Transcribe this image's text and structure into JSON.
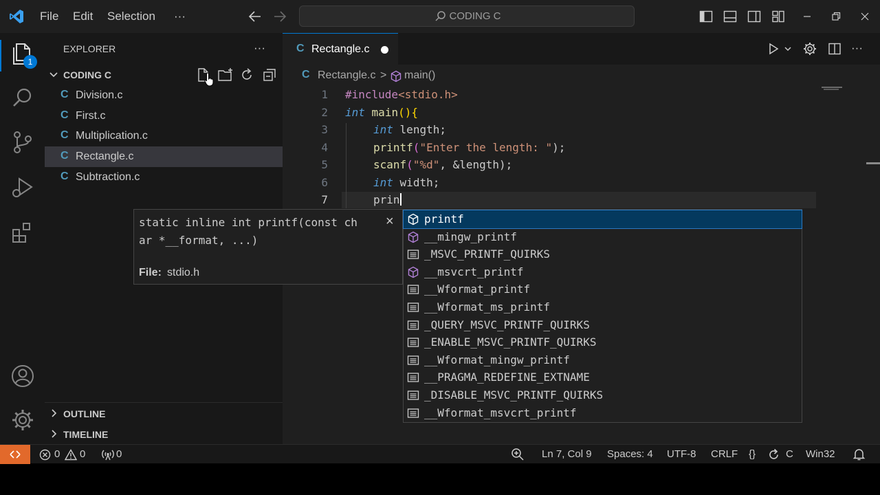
{
  "menu": {
    "file": "File",
    "edit": "Edit",
    "selection": "Selection",
    "more": "···"
  },
  "search": {
    "text": "CODING C"
  },
  "activity": {
    "explorer_badge": "1"
  },
  "explorer": {
    "title": "EXPLORER",
    "more": "···",
    "folder": "CODING C",
    "files": [
      {
        "label": "Division.c"
      },
      {
        "label": "First.c"
      },
      {
        "label": "Multiplication.c"
      },
      {
        "label": "Rectangle.c",
        "selected": true
      },
      {
        "label": "Subtraction.c"
      }
    ],
    "file_letter": "C",
    "outline": "OUTLINE",
    "timeline": "TIMELINE"
  },
  "tab": {
    "name": "Rectangle.c",
    "letter": "C"
  },
  "breadcrumb": {
    "file": "Rectangle.c",
    "symbol": "main()",
    "separator": ">"
  },
  "code": {
    "line_numbers": [
      "1",
      "2",
      "3",
      "4",
      "5",
      "6",
      "7"
    ],
    "l1": {
      "inc": "#include",
      "rest": "<stdio.h>"
    },
    "l2": {
      "kw": "int",
      "fn": "main",
      "p1": "()",
      "b": "{"
    },
    "l3": {
      "kw": "int",
      "rest": "length;"
    },
    "l4": {
      "fn": "printf",
      "p1": "(",
      "str": "\"Enter the length: \"",
      "p2": ");"
    },
    "l5": {
      "fn": "scanf",
      "p1": "(",
      "str": "\"%d\"",
      "p2": ", &",
      "var": "length",
      "p3": ");"
    },
    "l6": {
      "kw": "int",
      "rest": "width;"
    },
    "l7": {
      "text": "prin"
    }
  },
  "docs": {
    "signature_line1": "static inline int printf(const ch",
    "signature_line2": "ar *__format, ...)",
    "file_label": "File:",
    "file_value": "stdio.h",
    "close": "×"
  },
  "suggestions": [
    {
      "label": "printf",
      "kind": "function"
    },
    {
      "label": "__mingw_printf",
      "kind": "function"
    },
    {
      "label": "_MSVC_PRINTF_QUIRKS",
      "kind": "macro"
    },
    {
      "label": "__msvcrt_printf",
      "kind": "function"
    },
    {
      "label": "__Wformat_printf",
      "kind": "macro"
    },
    {
      "label": "__Wformat_ms_printf",
      "kind": "macro"
    },
    {
      "label": "_QUERY_MSVC_PRINTF_QUIRKS",
      "kind": "macro"
    },
    {
      "label": "_ENABLE_MSVC_PRINTF_QUIRKS",
      "kind": "macro"
    },
    {
      "label": "__Wformat_mingw_printf",
      "kind": "macro"
    },
    {
      "label": "__PRAGMA_REDEFINE_EXTNAME",
      "kind": "macro"
    },
    {
      "label": "_DISABLE_MSVC_PRINTF_QUIRKS",
      "kind": "macro"
    },
    {
      "label": "__Wformat_msvcrt_printf",
      "kind": "macro"
    }
  ],
  "status": {
    "errors": "0",
    "warnings": "0",
    "ports": "0",
    "position": "Ln 7, Col 9",
    "spaces": "Spaces: 4",
    "encoding": "UTF-8",
    "eol": "CRLF",
    "braces": "{}",
    "language": "C",
    "platform": "Win32"
  },
  "colors": {
    "accent": "#0078d4",
    "remote": "#e2692b",
    "c_icon": "#519aba"
  }
}
